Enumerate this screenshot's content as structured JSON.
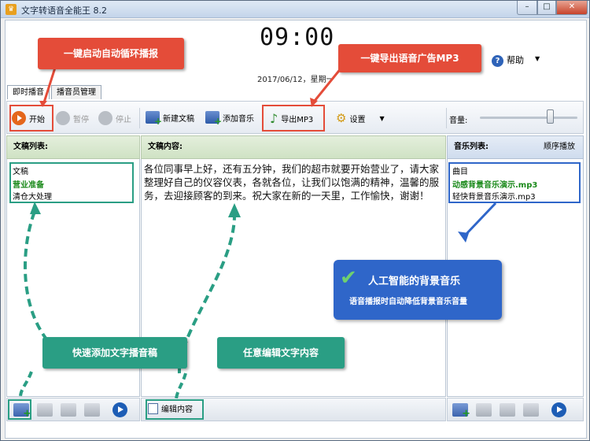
{
  "window": {
    "title": "文字转语音全能王 8.2",
    "controls": {
      "minimize": "–",
      "maximize": "□",
      "close": "✕"
    }
  },
  "clock": {
    "time": "09:00",
    "date": "2017/06/12，星期一"
  },
  "help": {
    "label": "帮助"
  },
  "tabs": [
    {
      "label": "即时播音"
    },
    {
      "label": "播音员管理"
    }
  ],
  "toolbar": {
    "start": "开始",
    "pause": "暂停",
    "stop": "停止",
    "new_script": "新建文稿",
    "add_music": "添加音乐",
    "export_mp3": "导出MP3",
    "settings": "设置",
    "volume_label": "音量:",
    "volume_level": 0.72
  },
  "panes": {
    "scripts_header": "文稿列表:",
    "content_header": "文稿内容:",
    "music_header": "音乐列表:",
    "music_mode": "顺序播放",
    "scripts": [
      "文稿",
      "营业准备",
      "清仓大处理"
    ],
    "script_content": "各位同事早上好，还有五分钟，我们的超市就要开始营业了，请大家整理好自己的仪容仪表，各就各位，让我们以饱满的精神，温馨的服务，去迎接顾客的到来。祝大家在新的一天里，工作愉快，谢谢！",
    "music": [
      "曲目",
      "动感背景音乐演示.mp3",
      "轻快背景音乐演示.mp3"
    ],
    "edit_button": "编辑内容"
  },
  "annotations": {
    "autoplay": "一键启动自动循环播报",
    "export": "一键导出语音广告MP3",
    "quick_add": "快速添加文字播音稿",
    "edit_any": "任意编辑文字内容",
    "ai_music_title": "人工智能的背景音乐",
    "ai_music_sub": "语音播报时自动降低背景音乐音量"
  }
}
